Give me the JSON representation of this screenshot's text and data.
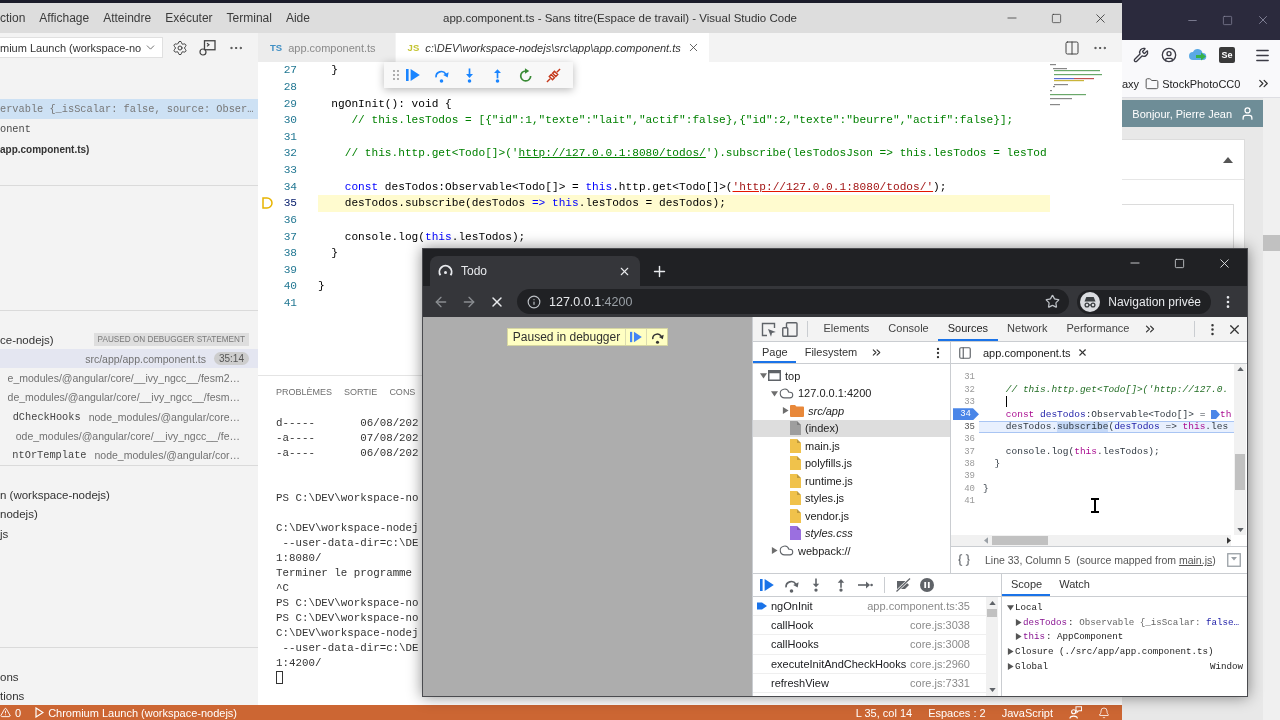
{
  "editor_app": {
    "menu": [
      "ction",
      "Affichage",
      "Atteindre",
      "Exécuter",
      "Terminal",
      "Aide"
    ],
    "title": "app.component.ts - Sans titre(Espace de travail) - Visual Studio Code",
    "launch_config": "mium Launch (workspace-no",
    "variables": [
      {
        "text": "ervable {_isScalar: false, source: Obser…",
        "kind": "value",
        "selected": true
      },
      {
        "text": "onent",
        "kind": "object",
        "selected": false
      },
      {
        "text": "app.component.ts)",
        "kind": "scope",
        "selected": false
      }
    ],
    "call_stack": {
      "session": "ce-nodejs)",
      "status": "PAUSED ON DEBUGGER STATEMENT",
      "frames": [
        {
          "file": "src/app/app.component.ts",
          "position": "35:14",
          "selected": true
        },
        {
          "file": "e_modules/@angular/core/__ivy_ngcc__/fesm2…",
          "selected": false
        },
        {
          "file": "de_modules/@angular/core/__ivy_ngcc__/fesm…",
          "selected": false
        },
        {
          "name": "dCheckHooks",
          "file": "node_modules/@angular/core…",
          "selected": false
        },
        {
          "file": "ode_modules/@angular/core/__ivy_ngcc__/fe…",
          "selected": false
        },
        {
          "name": "ntOrTemplate",
          "file": "node_modules/@angular/cor…",
          "selected": false
        }
      ]
    },
    "section_4": [
      "n (workspace-nodejs)",
      "nodejs)",
      "js"
    ],
    "section_5": [
      "ons",
      "tions"
    ],
    "tabs": [
      {
        "badge": "TS",
        "kind": "typescript",
        "label": "app.component.ts",
        "selected": false,
        "preview": false
      },
      {
        "badge": "JS",
        "kind": "javascript",
        "label": "c:\\DEV\\workspace-nodejs\\src\\app\\app.component.ts",
        "selected": true,
        "preview": true
      }
    ],
    "code": [
      {
        "number": "27",
        "paused": false,
        "tokens": [
          {
            "kind": "code",
            "text": "  }"
          }
        ]
      },
      {
        "number": "28",
        "paused": false
      },
      {
        "number": "29",
        "paused": false,
        "tokens": [
          {
            "kind": "code",
            "text": "  ngOnInit(): void {"
          }
        ]
      },
      {
        "number": "30",
        "paused": false,
        "tokens": [
          {
            "kind": "comment",
            "text": "     // this.lesTodos = [{\"id\":1,\"texte\":\"lait\",\"actif\":false},{\"id\":2,\"texte\":\"beurre\",\"actif\":false}];"
          }
        ]
      },
      {
        "number": "31",
        "paused": false
      },
      {
        "number": "32",
        "paused": false,
        "tokens": [
          {
            "kind": "comment",
            "text": "    // this.http.get<Todo[]>('"
          },
          {
            "kind": "comment_link",
            "text": "http://127.0.0.1:8080/todos/"
          },
          {
            "kind": "comment",
            "text": "').subscribe(lesTodosJson => this.lesTodos = lesTod"
          }
        ]
      },
      {
        "number": "33",
        "paused": false
      },
      {
        "number": "34",
        "paused": false,
        "tokens": [
          {
            "kind": "keyword",
            "text": "    const"
          },
          {
            "kind": "code",
            "text": " desTodos:Observable<Todo[]> = "
          },
          {
            "kind": "keyword",
            "text": "this"
          },
          {
            "kind": "code",
            "text": ".http.get<Todo[]>("
          },
          {
            "kind": "string_link",
            "text": "'http://127.0.0.1:8080/todos/'"
          },
          {
            "kind": "code",
            "text": ");"
          }
        ]
      },
      {
        "number": "35",
        "paused": true,
        "tokens": [
          {
            "kind": "code",
            "text": "    desTodos.subscribe(desTodos "
          },
          {
            "kind": "keyword",
            "text": "=> this"
          },
          {
            "kind": "code",
            "text": ".lesTodos = desTodos);"
          }
        ]
      },
      {
        "number": "36",
        "paused": false
      },
      {
        "number": "37",
        "paused": false,
        "tokens": [
          {
            "kind": "code",
            "text": "    console.log("
          },
          {
            "kind": "keyword",
            "text": "this"
          },
          {
            "kind": "code",
            "text": ".lesTodos);"
          }
        ]
      },
      {
        "number": "38",
        "paused": false,
        "tokens": [
          {
            "kind": "code",
            "text": "  }"
          }
        ]
      },
      {
        "number": "39",
        "paused": false
      },
      {
        "number": "40",
        "paused": false,
        "tokens": [
          {
            "kind": "code",
            "text": "}"
          }
        ]
      },
      {
        "number": "41",
        "paused": false
      }
    ],
    "panel": {
      "tabs": [
        "PROBLÈMES",
        "SORTIE",
        "CONS"
      ],
      "terminal": [
        {
          "kind": "text",
          "text": "d-----       06/08/202"
        },
        {
          "kind": "text",
          "text": "-a----       07/08/202"
        },
        {
          "kind": "text",
          "text": "-a----       06/08/202"
        },
        {
          "kind": "blank"
        },
        {
          "kind": "blank"
        },
        {
          "kind": "text",
          "text": "PS C:\\DEV\\workspace-no"
        },
        {
          "kind": "blank"
        },
        {
          "kind": "text",
          "text": "C:\\DEV\\workspace-nodej"
        },
        {
          "kind": "text",
          "text": " --user-data-dir=c:\\DE"
        },
        {
          "kind": "text",
          "text": "1:8080/"
        },
        {
          "kind": "text",
          "text": "Terminer le programme"
        },
        {
          "kind": "text",
          "text": "^C"
        },
        {
          "kind": "text",
          "text": "PS C:\\DEV\\workspace-no"
        },
        {
          "kind": "text",
          "text": "PS C:\\DEV\\workspace-no"
        },
        {
          "kind": "text",
          "text": "C:\\DEV\\workspace-nodej"
        },
        {
          "kind": "text",
          "text": " --user-data-dir=c:\\DE"
        },
        {
          "kind": "text",
          "text": "1:4200/"
        },
        {
          "kind": "cursor"
        }
      ]
    },
    "status_bar": {
      "problems": "0",
      "session": "Chromium Launch (workspace-nodejs)",
      "position": "L 35, col 14",
      "indentation": "Espaces : 2",
      "language": "JavaScript"
    }
  },
  "browser": {
    "tab": {
      "title": "Todo",
      "loading": true
    },
    "address": {
      "host": "127.0.0.1",
      "port": ":4200"
    },
    "profile": "Navigation privée",
    "banner": "Paused in debugger",
    "devtools": {
      "tabs": [
        {
          "label": "Elements",
          "selected": false
        },
        {
          "label": "Console",
          "selected": false
        },
        {
          "label": "Sources",
          "selected": true
        },
        {
          "label": "Network",
          "selected": false
        },
        {
          "label": "Performance",
          "selected": false
        }
      ],
      "navigator_tabs": [
        {
          "label": "Page",
          "selected": true
        },
        {
          "label": "Filesystem",
          "selected": false
        }
      ],
      "tree": [
        {
          "label": "top",
          "kind": "frame",
          "expanded": true,
          "selected": false,
          "children": [
            {
              "label": "127.0.0.1:4200",
              "kind": "origin",
              "expanded": true,
              "selected": false,
              "children": [
                {
                  "label": "src/app",
                  "kind": "folder",
                  "expanded": false,
                  "selected": false
                },
                {
                  "label": "(index)",
                  "kind": "document",
                  "selected": true
                },
                {
                  "label": "main.js",
                  "kind": "script",
                  "selected": false
                },
                {
                  "label": "polyfills.js",
                  "kind": "script",
                  "selected": false
                },
                {
                  "label": "runtime.js",
                  "kind": "script",
                  "selected": false
                },
                {
                  "label": "styles.js",
                  "kind": "script",
                  "selected": false
                },
                {
                  "label": "vendor.js",
                  "kind": "script",
                  "selected": false
                },
                {
                  "label": "styles.css",
                  "kind": "stylesheet",
                  "selected": false
                }
              ]
            },
            {
              "label": "webpack://",
              "kind": "origin",
              "expanded": false,
              "selected": false
            }
          ]
        }
      ],
      "source_file": "app.component.ts",
      "source_lines": [
        {
          "number": "31",
          "breakpoint": false,
          "current": false,
          "caret": false
        },
        {
          "number": "32",
          "breakpoint": false,
          "current": false,
          "caret": false,
          "tokens": [
            {
              "kind": "comment",
              "text": "    // this.http.get<Todo[]>('http://127.0."
            }
          ]
        },
        {
          "number": "33",
          "breakpoint": false,
          "current": false,
          "caret": true
        },
        {
          "number": "34",
          "breakpoint": true,
          "current": false,
          "caret": false,
          "tokens": [
            {
              "kind": "keyword",
              "text": "    const"
            },
            {
              "kind": "variable",
              "text": " desTodos"
            },
            {
              "kind": "code",
              "text": ":Observable<Todo[]> = "
            },
            {
              "kind": "marker"
            },
            {
              "kind": "keyword",
              "text": "th"
            }
          ]
        },
        {
          "number": "35",
          "breakpoint": false,
          "current": true,
          "caret": false,
          "tokens": [
            {
              "kind": "code",
              "text": "    desTodos."
            },
            {
              "kind": "selection",
              "text": "subscribe"
            },
            {
              "kind": "code",
              "text": "("
            },
            {
              "kind": "variable",
              "text": "desTodos"
            },
            {
              "kind": "code",
              "text": " => "
            },
            {
              "kind": "keyword",
              "text": "this"
            },
            {
              "kind": "code",
              "text": ".les"
            }
          ]
        },
        {
          "number": "36",
          "breakpoint": false,
          "current": false,
          "caret": false
        },
        {
          "number": "37",
          "breakpoint": false,
          "current": false,
          "caret": false,
          "tokens": [
            {
              "kind": "code",
              "text": "    console.log("
            },
            {
              "kind": "keyword",
              "text": "this"
            },
            {
              "kind": "code",
              "text": ".lesTodos);"
            }
          ]
        },
        {
          "number": "38",
          "breakpoint": false,
          "current": false,
          "caret": false,
          "tokens": [
            {
              "kind": "code",
              "text": "  }"
            }
          ]
        },
        {
          "number": "39",
          "breakpoint": false,
          "current": false,
          "caret": false
        },
        {
          "number": "40",
          "breakpoint": false,
          "current": false,
          "caret": false,
          "tokens": [
            {
              "kind": "code",
              "text": "}"
            }
          ]
        },
        {
          "number": "41",
          "breakpoint": false,
          "current": false,
          "caret": false
        }
      ],
      "cursor_position": "Line 33, Column 5",
      "source_map": {
        "text": "(source mapped from ",
        "link": "main.js",
        "end": ")"
      },
      "call_stack": [
        {
          "name": "ngOnInit",
          "location": "app.component.ts:35",
          "selected": true
        },
        {
          "name": "callHook",
          "location": "core.js:3038",
          "selected": false
        },
        {
          "name": "callHooks",
          "location": "core.js:3008",
          "selected": false
        },
        {
          "name": "executeInitAndCheckHooks",
          "location": "core.js:2960",
          "selected": false
        },
        {
          "name": "refreshView",
          "location": "core.js:7331",
          "selected": false
        }
      ],
      "scope_tabs": [
        {
          "label": "Scope",
          "selected": true
        },
        {
          "label": "Watch",
          "selected": false
        }
      ],
      "scope": [
        {
          "label": "Local",
          "kind": "scope",
          "expanded": true,
          "children": [
            {
              "label": "desTodos",
              "kind": "property",
              "expanded": false,
              "value": [
                {
                  "kind": "punct",
                  "text": ": "
                },
                {
                  "kind": "type",
                  "text": "Observable {_isScalar: "
                },
                {
                  "kind": "literal",
                  "text": "false…"
                }
              ]
            },
            {
              "label": "this",
              "kind": "property",
              "expanded": false,
              "value": [
                {
                  "kind": "punct",
                  "text": ": "
                },
                {
                  "kind": "plain",
                  "text": "AppComponent"
                }
              ]
            }
          ]
        },
        {
          "label": "Closure (./src/app/app.component.ts)",
          "kind": "scope",
          "expanded": false
        },
        {
          "label": "Global",
          "kind": "scope",
          "expanded": false,
          "value": [
            {
              "kind": "plain",
              "text": "Window"
            }
          ]
        }
      ]
    }
  },
  "background_browser": {
    "extension_badge": "Se",
    "bookmarks": [
      {
        "label": "axy",
        "kind": "plain"
      },
      {
        "label": "StockPhotoCC0",
        "kind": "folder"
      }
    ],
    "greeting": "Bonjour, Pierre Jean"
  }
}
